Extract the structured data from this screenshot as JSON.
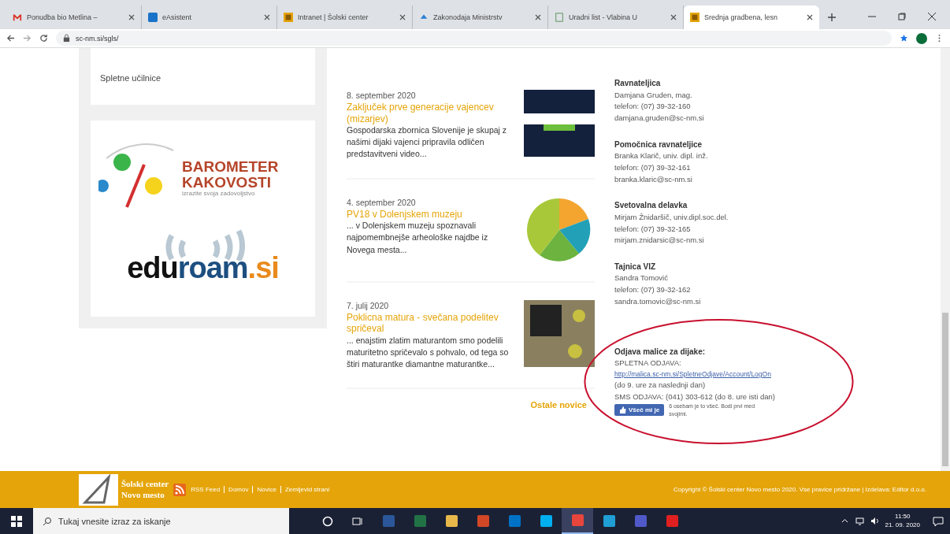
{
  "browser": {
    "tabs": [
      {
        "title": "Ponudba bio Metlina –",
        "selected": false
      },
      {
        "title": "eAsistent",
        "selected": false
      },
      {
        "title": "Intranet | Šolski center",
        "selected": false
      },
      {
        "title": "Zakonodaja Ministrstv",
        "selected": false
      },
      {
        "title": "Uradni list - Vlabina U",
        "selected": false
      },
      {
        "title": "Srednja gradbena, lesn",
        "selected": true
      }
    ],
    "address": "sc-nm.si/sgls/"
  },
  "sidebar": {
    "link": "Spletne učilnice",
    "barometer": {
      "line1": "BAROMETER",
      "line2": "KAKOVOSTI",
      "tagline": "izrazite svoja zadovoljstvo"
    },
    "eduroam": [
      "edu",
      "roam",
      ".si"
    ]
  },
  "news": [
    {
      "date": "8. september 2020",
      "title": "Zaključek prve generacije vajencev (mizarjev)",
      "excerpt": "Gospodarska zbornica Slovenije je skupaj z našimi dijaki vajenci pripravila odličen predstavitveni video..."
    },
    {
      "date": "4. september 2020",
      "title": "PV18 v Dolenjskem muzeju",
      "excerpt": "... v Dolenjskem muzeju spoznavali najpomembnejše arheološke najdbe iz Novega mesta..."
    },
    {
      "date": "7. julij 2020",
      "title": "Poklicna matura - svečana podelitev spričeval",
      "excerpt": "... enajstim zlatim maturantom smo podelili maturitetno spričevalo s pohvalo, od tega so štiri maturantke diamantne maturantke..."
    }
  ],
  "more_news": "Ostale novice",
  "contacts": [
    {
      "role": "Ravnateljica",
      "name": "Damjana Gruden, mag.",
      "phone": "telefon: (07) 39-32-160",
      "email": "damjana.gruden@sc-nm.si"
    },
    {
      "role": "Pomočnica ravnateljice",
      "name": "Branka Klarič, univ. dipl. inž.",
      "phone": "telefon: (07) 39-32-161",
      "email": "branka.klaric@sc-nm.si"
    },
    {
      "role": "Svetovalna delavka",
      "name": "Mirjam Žnidaršič, univ.dipl.soc.del.",
      "phone": "telefon: (07) 39-32-165",
      "email": "mirjam.znidarsic@sc-nm.si"
    },
    {
      "role": "Tajnica VIZ",
      "name": "Sandra Tomović",
      "phone": "telefon: (07) 39-32-162",
      "email": "sandra.tomovic@sc-nm.si"
    }
  ],
  "lunch": {
    "heading": "Odjava malice za dijake:",
    "web_label": "SPLETNA ODJAVA:",
    "web_link": "http://malica.sc-nm.si/SpletneOdjave/Account/LogOn",
    "web_note": "(do 9. ure za naslednji dan)",
    "sms": "SMS ODJAVA: (041) 303-612 (do 8. ure isti dan)",
    "like_button": "Všeč mi je",
    "like_text": "6 osebam je to všeč. Bodi prvi med svojimi."
  },
  "footer": {
    "brand": [
      "Šolski center",
      "Novo mesto"
    ],
    "links": [
      "RSS Feed",
      "Domov",
      "Novice",
      "Zemljevid strani"
    ],
    "copyright": "Copyright © Šolski center Novo mesto 2020. Vse pravice pridržane | Izdelava: Editor d.o.o."
  },
  "taskbar": {
    "search_placeholder": "Tukaj vnesite izraz za iskanje",
    "apps": [
      {
        "color": "#2b579a",
        "selected": false
      },
      {
        "color": "#217346",
        "selected": false
      },
      {
        "color": "#e8b84a",
        "selected": false
      },
      {
        "color": "#d24726",
        "selected": false
      },
      {
        "color": "#0072c6",
        "selected": false
      },
      {
        "color": "#00aff0",
        "selected": false
      },
      {
        "color": "#e8453c",
        "selected": true
      },
      {
        "color": "#1f9fd6",
        "selected": false
      },
      {
        "color": "#5059c9",
        "selected": false
      },
      {
        "color": "#e02020",
        "selected": false
      }
    ],
    "time": "11:50",
    "date": "21. 09. 2020"
  }
}
